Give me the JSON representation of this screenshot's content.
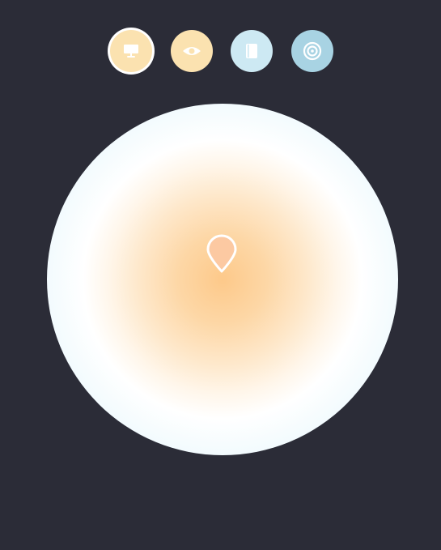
{
  "mode_bar": {
    "modes": [
      {
        "icon": "monitor-icon",
        "color": "#fbe2b0",
        "selected": true
      },
      {
        "icon": "eye-icon",
        "color": "#fbe2b0",
        "selected": false
      },
      {
        "icon": "book-icon",
        "color": "#cde9f3",
        "selected": false
      },
      {
        "icon": "target-icon",
        "color": "#a8d3e3",
        "selected": false
      }
    ]
  },
  "color_wheel": {
    "center_color": "#fdc98a",
    "edge_color": "#d2ebf5",
    "picker_color": "#fcc9a2"
  },
  "background_color": "#2b2c37"
}
